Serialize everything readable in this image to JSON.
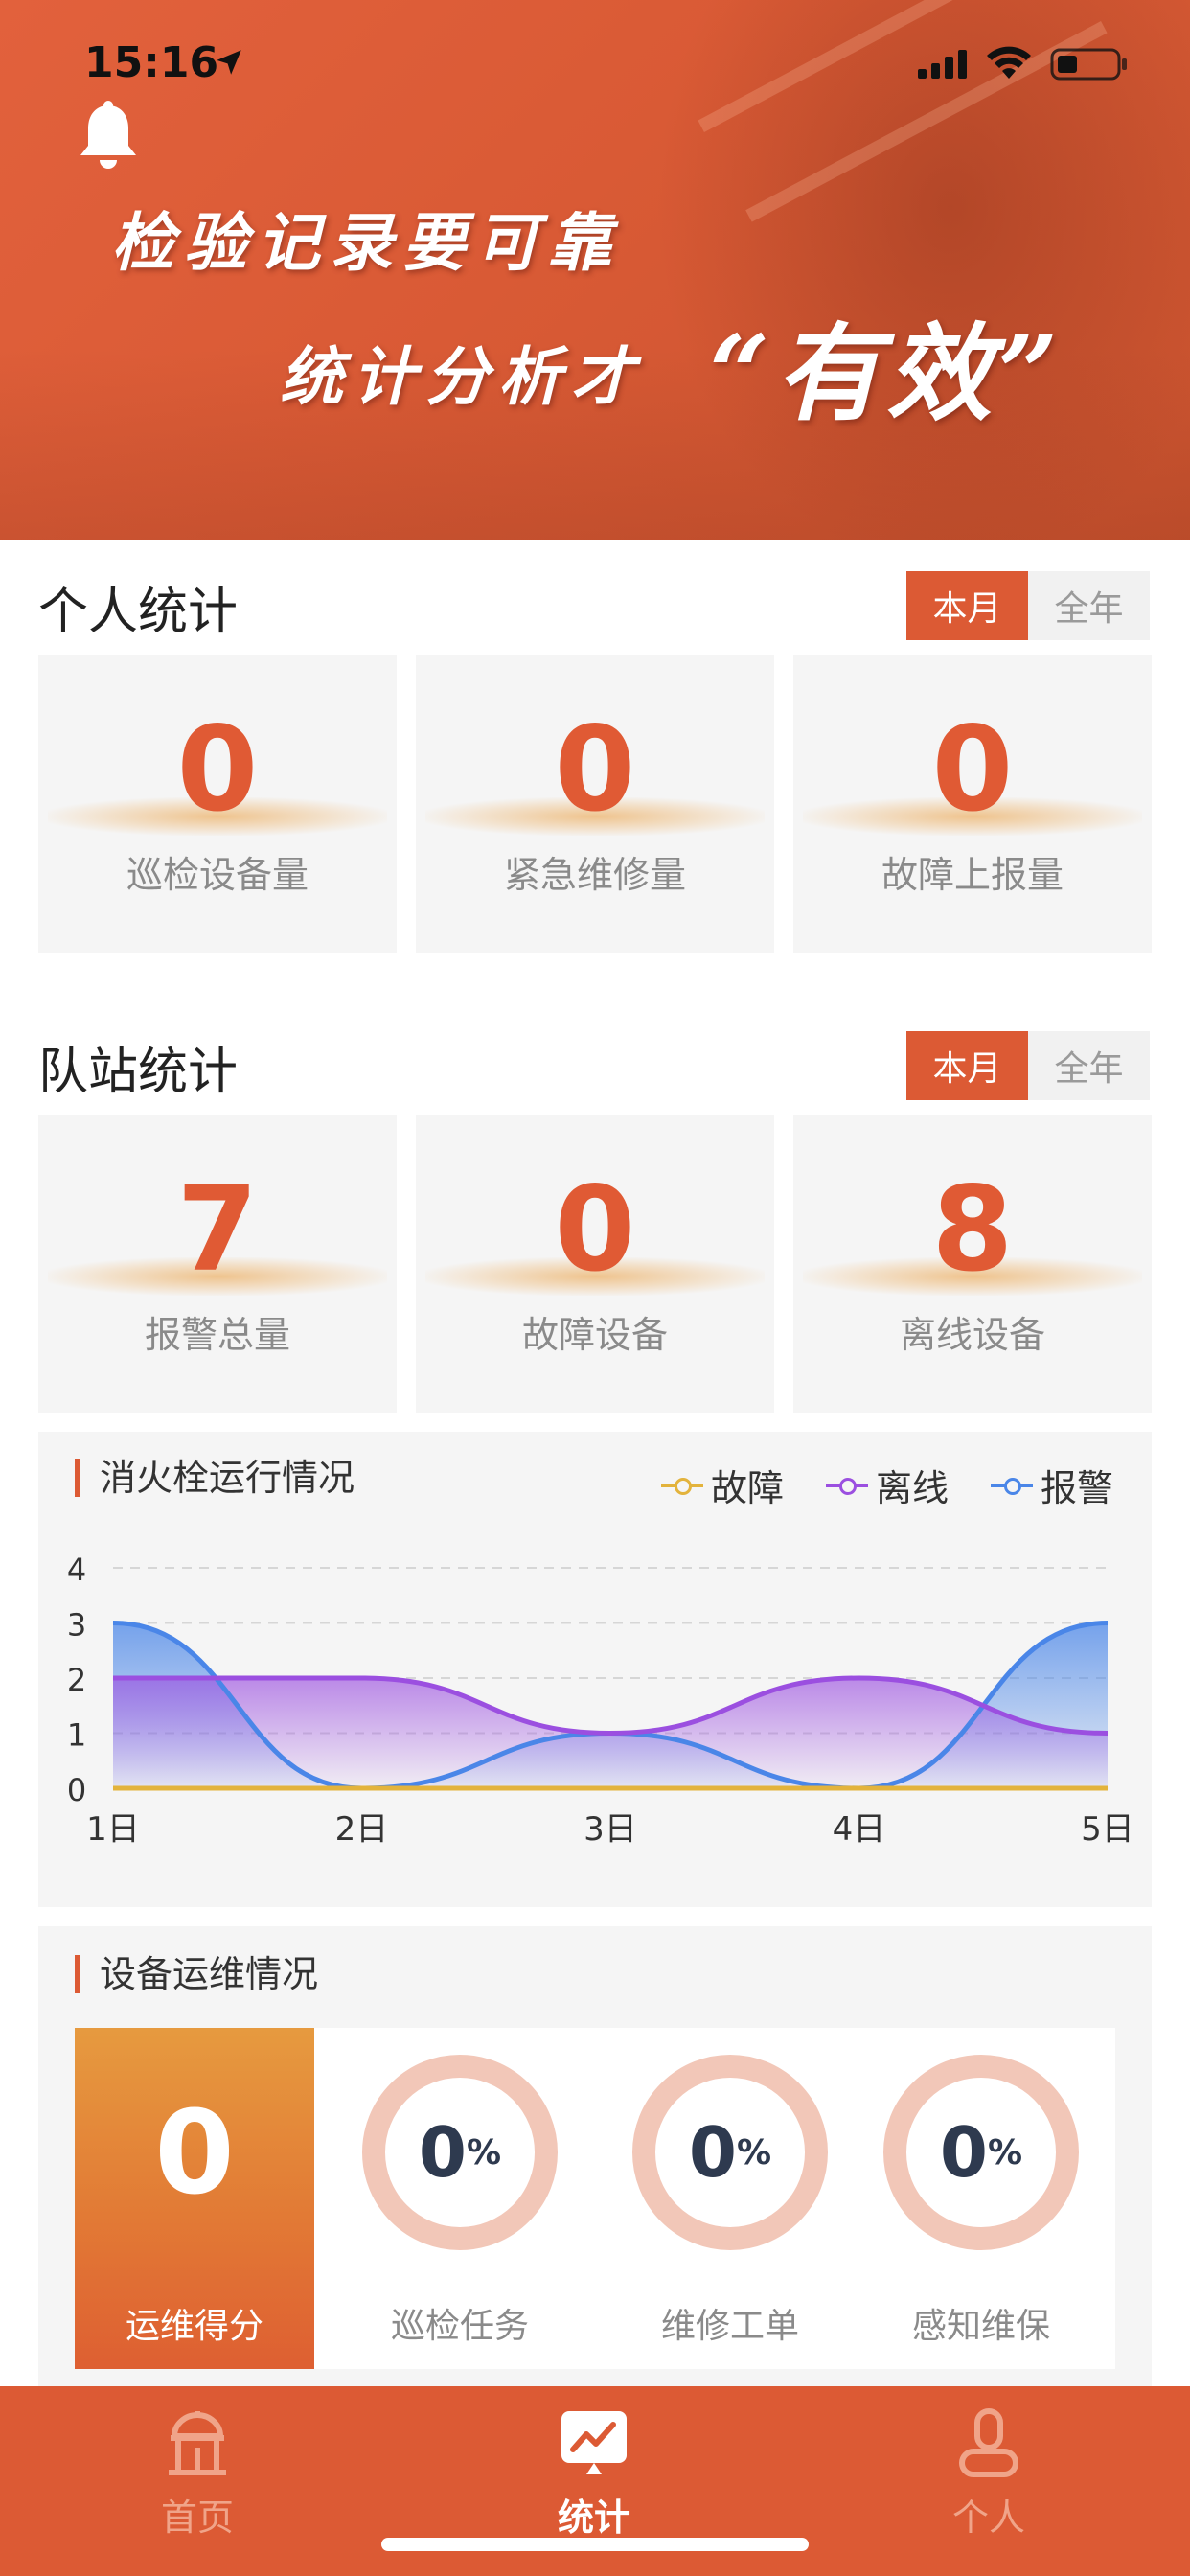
{
  "status_bar": {
    "time": "15:16"
  },
  "banner": {
    "line1": "检验记录要可靠",
    "line2": "统计分析才",
    "line3": "“有效”"
  },
  "personal": {
    "title": "个人统计",
    "toggle": {
      "month": "本月",
      "year": "全年"
    },
    "stats": [
      {
        "value": "0",
        "label": "巡检设备量"
      },
      {
        "value": "0",
        "label": "紧急维修量"
      },
      {
        "value": "0",
        "label": "故障上报量"
      }
    ]
  },
  "station": {
    "title": "队站统计",
    "toggle": {
      "month": "本月",
      "year": "全年"
    },
    "stats": [
      {
        "value": "7",
        "label": "报警总量"
      },
      {
        "value": "0",
        "label": "故障设备"
      },
      {
        "value": "8",
        "label": "离线设备"
      }
    ]
  },
  "hydrant_panel": {
    "title": "消火栓运行情况"
  },
  "chart_data": {
    "type": "area",
    "title": "消火栓运行情况",
    "categories": [
      "1日",
      "2日",
      "3日",
      "4日",
      "5日"
    ],
    "ylim": [
      0,
      4
    ],
    "yticks": [
      "0",
      "1",
      "2",
      "3",
      "4"
    ],
    "grid": true,
    "legend_position": "top-right",
    "series": [
      {
        "name": "故障",
        "color": "#e3b33c",
        "values": [
          0,
          0,
          0,
          0,
          0
        ]
      },
      {
        "name": "离线",
        "color": "#9b4fe0",
        "values": [
          2,
          2,
          1,
          2,
          1
        ]
      },
      {
        "name": "报警",
        "color": "#4a86e8",
        "values": [
          3,
          0,
          1,
          0,
          3
        ]
      }
    ]
  },
  "ops_panel": {
    "title": "设备运维情况",
    "score": {
      "value": "0",
      "label": "运维得分"
    },
    "rings": [
      {
        "value": "0",
        "unit": "%",
        "label": "巡检任务",
        "percent": 0
      },
      {
        "value": "0",
        "unit": "%",
        "label": "维修工单",
        "percent": 0
      },
      {
        "value": "0",
        "unit": "%",
        "label": "感知维保",
        "percent": 0
      }
    ]
  },
  "tabbar": {
    "tabs": [
      {
        "label": "首页",
        "icon": "home-icon",
        "active": false
      },
      {
        "label": "统计",
        "icon": "chart-icon",
        "active": true
      },
      {
        "label": "个人",
        "icon": "person-icon",
        "active": false
      }
    ]
  },
  "colors": {
    "accent": "#dc5a34",
    "ring": "#f2c7b8",
    "score_top": "#e69a3f"
  }
}
